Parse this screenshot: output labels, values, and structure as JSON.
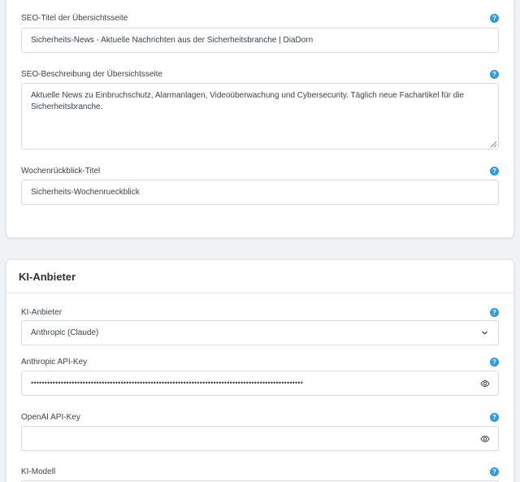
{
  "seo": {
    "title_label": "SEO-Titel der Übersichtsseite",
    "title_value": "Sicherheits-News - Aktuelle Nachrichten aus der Sicherheitsbranche | DiaDorn",
    "description_label": "SEO-Beschreibung der Übersichtsseite",
    "description_value": "Aktuelle News zu Einbruchschutz, Alarmanlagen, Videoüberwachung und Cybersecurity. Täglich neue Fachartikel für die Sicherheitsbranche.",
    "weekly_label": "Wochenrückblick-Titel",
    "weekly_value": "Sicherheits-Wochenrueckblick"
  },
  "ki": {
    "section_title": "KI-Anbieter",
    "provider_label": "KI-Anbieter",
    "provider_value": "Anthropic (Claude)",
    "anthropic_key_label": "Anthropic API-Key",
    "anthropic_key_masked": "••••••••••••••••••••••••••••••••••••••••••••••••••••••••••••••••••••••••••••••••••••••••••••••••••••",
    "openai_key_label": "OpenAI API-Key",
    "openai_key_value": "",
    "model_label": "KI-Modell"
  },
  "help_glyph": "?",
  "icons": {
    "help": "help-icon",
    "eye": "eye-icon",
    "chevron": "chevron-down-icon"
  },
  "colors": {
    "accent": "#2e9be0",
    "background": "#f1f2f4",
    "card": "#ffffff",
    "border": "#d8dbe0",
    "text": "#3c434a"
  }
}
